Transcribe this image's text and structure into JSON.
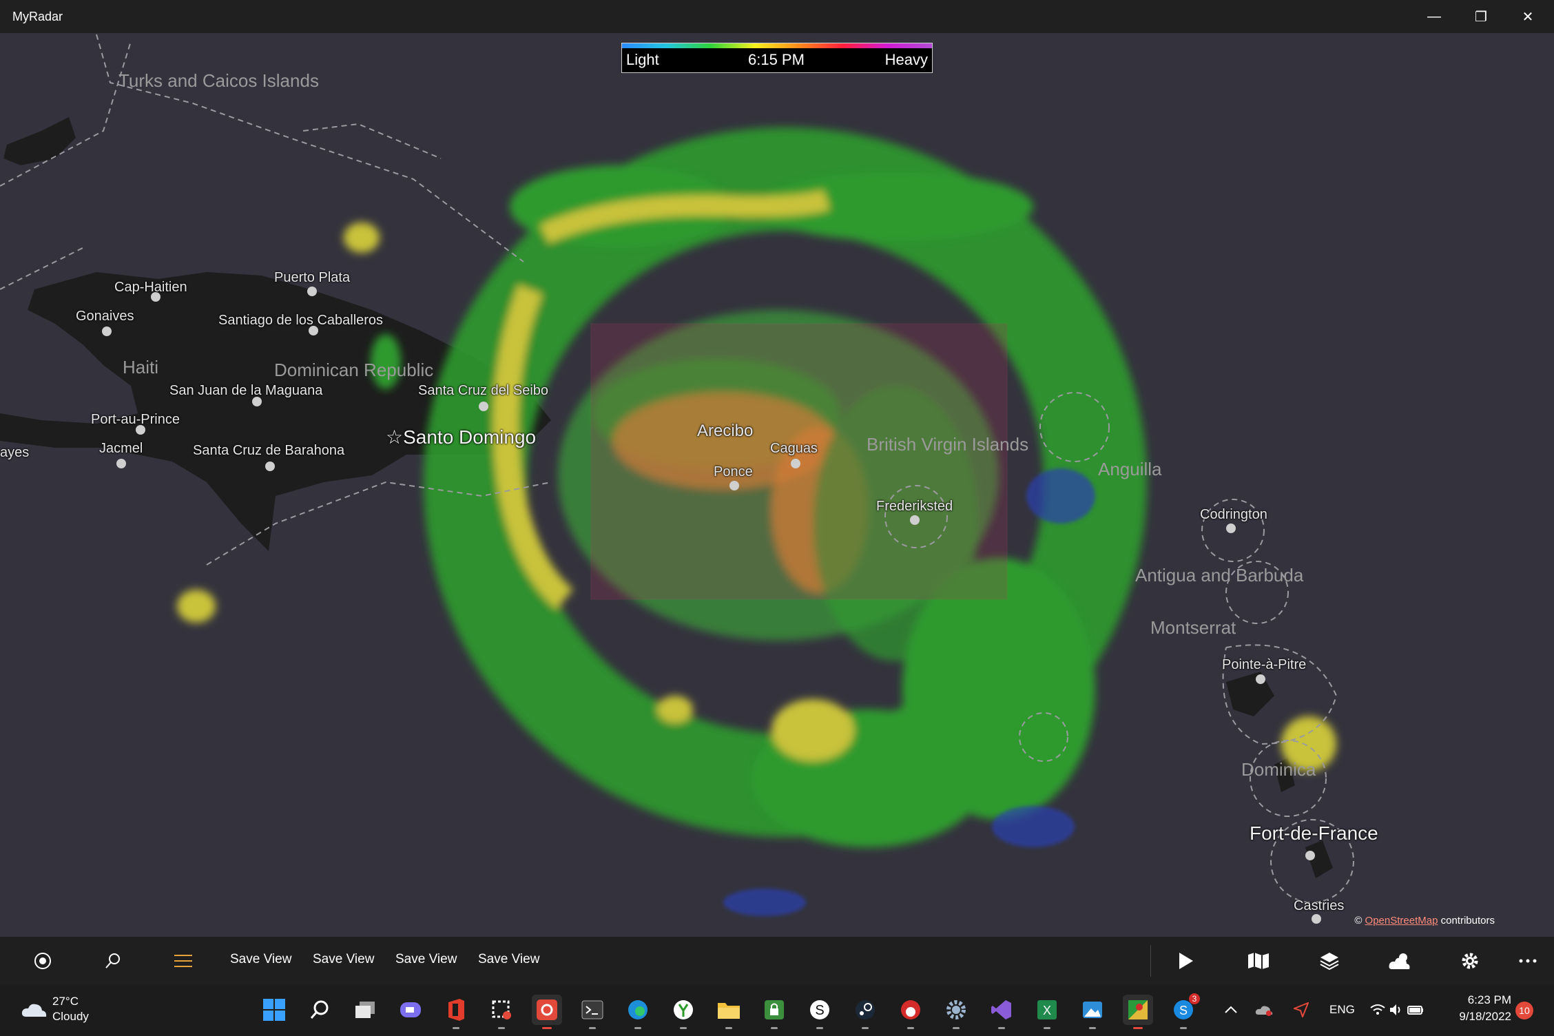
{
  "window": {
    "title": "MyRadar",
    "minimize": "—",
    "restore": "❐",
    "close": "✕"
  },
  "legend": {
    "left": "Light",
    "time": "6:15 PM",
    "right": "Heavy"
  },
  "places": {
    "turks": "Turks and Caicos Islands",
    "cap_haitien": "Cap-Haitien",
    "puerto_plata": "Puerto Plata",
    "gonaives": "Gonaives",
    "santiago": "Santiago de los Caballeros",
    "haiti": "Haiti",
    "dominican_republic": "Dominican Republic",
    "san_juan_maguana": "San Juan de la Maguana",
    "santa_cruz_seibo": "Santa Cruz del Seibo",
    "port_au_prince": "Port-au-Prince",
    "santo_domingo": "Santo Domingo",
    "jacmel": "Jacmel",
    "santa_cruz_barahona": "Santa Cruz de Barahona",
    "ayes": "ayes",
    "arecibo": "Arecibo",
    "caguas": "Caguas",
    "ponce": "Ponce",
    "bvi": "British Virgin Islands",
    "anguilla": "Anguilla",
    "frederiksted": "Frederiksted",
    "codrington": "Codrington",
    "antigua": "Antigua and Barbuda",
    "montserrat": "Montserrat",
    "pointe_a_pitre": "Pointe-à-Pitre",
    "dominica": "Dominica",
    "fort_de_france": "Fort-de-France",
    "castries": "Castries"
  },
  "attribution": {
    "prefix": "©",
    "link": "OpenStreetMap",
    "suffix": "contributors"
  },
  "commandbar": {
    "save_views": [
      "Save View",
      "Save View",
      "Save View",
      "Save View"
    ]
  },
  "taskbar": {
    "weather_temp": "27°C",
    "weather_desc": "Cloudy",
    "lang": "ENG",
    "time": "6:23 PM",
    "date": "9/18/2022",
    "notifications": "10",
    "skype_badge": "3"
  },
  "colors": {
    "accent": "#e2493b",
    "radar_green": "#3aa93a",
    "radar_yellow": "#c9c23a",
    "radar_orange": "#d9912e"
  }
}
